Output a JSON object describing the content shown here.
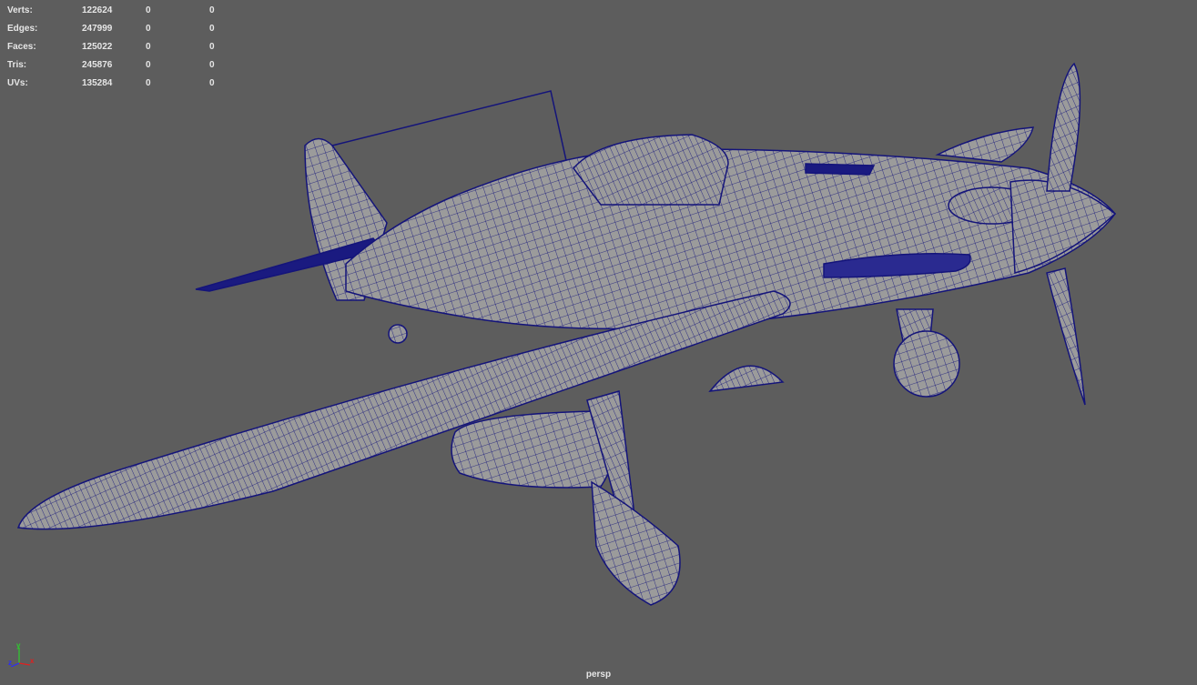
{
  "hud": {
    "rows": [
      {
        "label": "Verts:",
        "total": "122624",
        "selected": "0",
        "components": "0"
      },
      {
        "label": "Edges:",
        "total": "247999",
        "selected": "0",
        "components": "0"
      },
      {
        "label": "Faces:",
        "total": "125022",
        "selected": "0",
        "components": "0"
      },
      {
        "label": "Tris:",
        "total": "245876",
        "selected": "0",
        "components": "0"
      },
      {
        "label": "UVs:",
        "total": "135284",
        "selected": "0",
        "components": "0"
      }
    ]
  },
  "viewport": {
    "camera": "persp",
    "background": "#5d5d5d",
    "mesh_fill": "#9b9b9b",
    "wire_color": "#14147a"
  },
  "axis": {
    "x": "x",
    "y": "y",
    "z": "z"
  }
}
